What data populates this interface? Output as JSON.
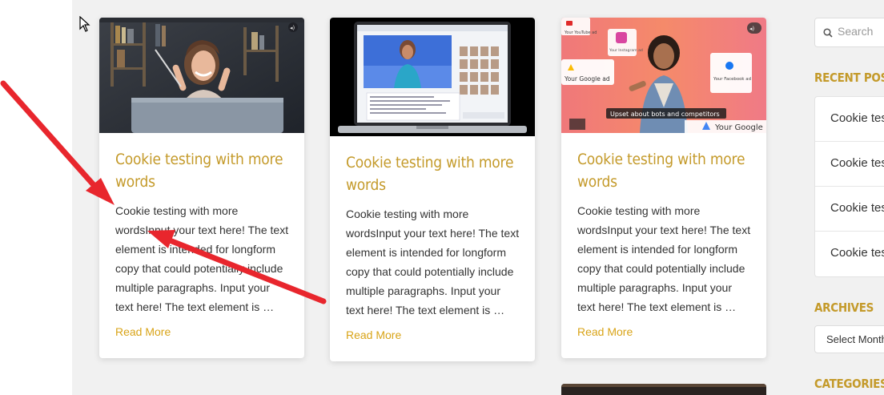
{
  "posts": [
    {
      "title_line1": "Cookie testing with more",
      "title_line2": "words",
      "excerpt": [
        "Cookie testing with more",
        "wordsInput your text here! The text",
        "element is intended for longform",
        "copy that could potentially include",
        "multiple paragraphs. Input your",
        "text here! The text element is …"
      ],
      "read_more": "Read More"
    },
    {
      "title_line1": "Cookie testing with more",
      "title_line2": "words",
      "excerpt": [
        "Cookie testing with more",
        "wordsInput your text here! The text",
        "element is intended for longform",
        "copy that could potentially include",
        "multiple paragraphs. Input your",
        "text here! The text element is …"
      ],
      "read_more": "Read More"
    },
    {
      "title_line1": "Cookie testing with more",
      "title_line2": "words",
      "excerpt": [
        "Cookie testing with more",
        "wordsInput your text here! The text",
        "element is intended for longform",
        "copy that could potentially include",
        "multiple paragraphs. Input your",
        "text here! The text element is …"
      ],
      "read_more": "Read More"
    }
  ],
  "thumb3": {
    "yt_label": "Your YouTube ad",
    "ig_label": "Your Instagram ad",
    "fb_label": "Your Facebook ad",
    "google_label": "Your Google ad",
    "caption": "Upset about bots and competitors",
    "google_label2": "Your Google"
  },
  "sidebar": {
    "search_placeholder": "Search",
    "recent_heading": "RECENT POSTS",
    "recent_items": [
      "Cookie testing with more words",
      "Cookie testing with more words",
      "Cookie testing with more words",
      "Cookie testing with more words"
    ],
    "archives_heading": "ARCHIVES",
    "archives_select": "Select Month",
    "categories_heading": "CATEGORIES"
  },
  "colors": {
    "accent": "#c49a2a",
    "link": "#d9a418",
    "arrow": "#e8262d"
  }
}
